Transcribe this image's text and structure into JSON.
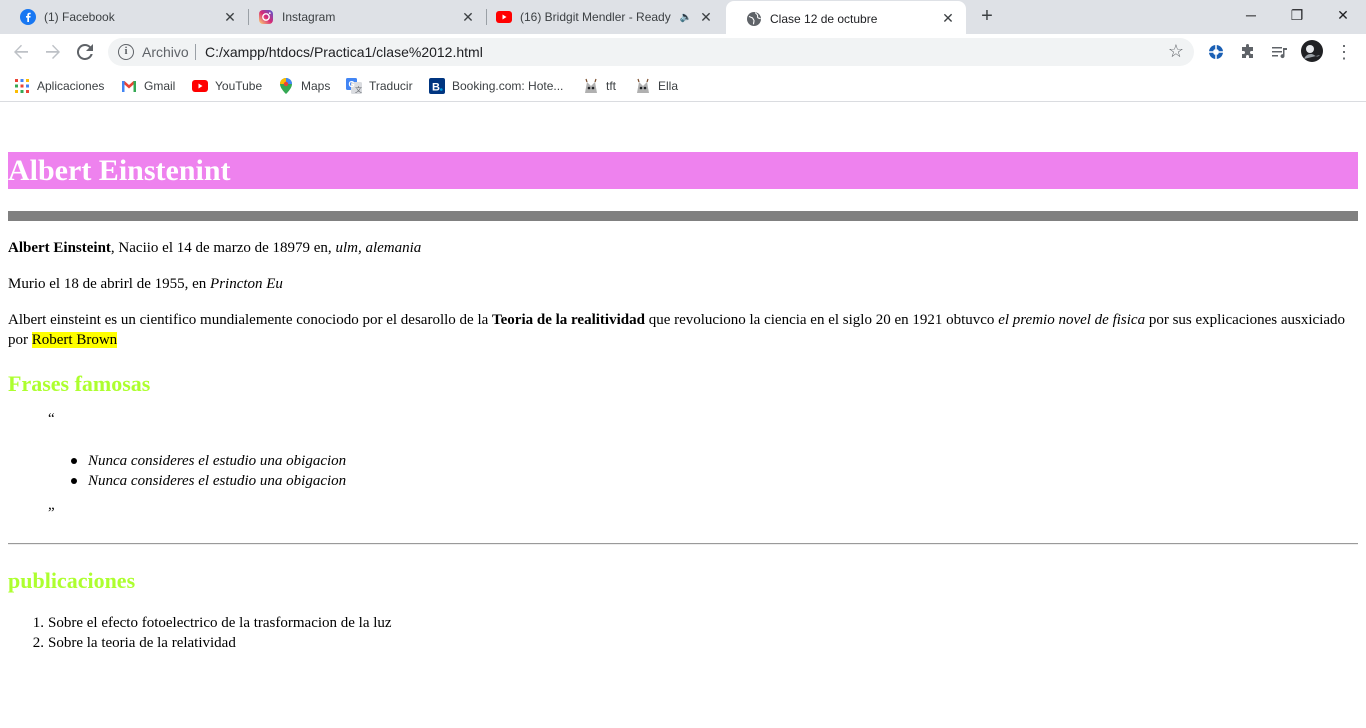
{
  "tabs": [
    {
      "title": "(1) Facebook",
      "icon": "facebook-icon",
      "color": "#1877f2"
    },
    {
      "title": "Instagram",
      "icon": "instagram-icon",
      "color": "#e1306c"
    },
    {
      "title": "(16) Bridgit Mendler - Ready",
      "icon": "youtube-icon",
      "color": "#ff0000",
      "audio": "🔈"
    },
    {
      "title": "Clase 12 de octubre",
      "icon": "globe-icon",
      "active": true
    }
  ],
  "window": {
    "minimize": "─",
    "restore": "❐",
    "close": "✕",
    "new_tab": "+"
  },
  "toolbar": {
    "scheme_label": "Archivo",
    "url": "C:/xampp/htdocs/Practica1/clase%2012.html"
  },
  "bookmarks": [
    {
      "label": "Aplicaciones",
      "icon": "apps-grid-icon"
    },
    {
      "label": "Gmail",
      "icon": "gmail-icon"
    },
    {
      "label": "YouTube",
      "icon": "youtube-icon"
    },
    {
      "label": "Maps",
      "icon": "maps-pin-icon"
    },
    {
      "label": "Traducir",
      "icon": "translate-icon"
    },
    {
      "label": "Booking.com: Hote...",
      "icon": "booking-icon"
    },
    {
      "label": "tft",
      "icon": "tft-icon"
    },
    {
      "label": "Ella",
      "icon": "ella-icon"
    }
  ],
  "page": {
    "heading": "Albert Einstenint",
    "p1": {
      "bold": "Albert Einsteint",
      "text": ", Naciio el 14 de marzo de 18979 en, ",
      "italic": "ulm, alemania"
    },
    "p2": {
      "text": "Murio el 18 de abrirl de 1955, en ",
      "italic": "Princton Eu"
    },
    "p3": {
      "t1": "Albert einsteint es un cientifico mundialemente conociodo por el desarollo de la ",
      "b1": "Teoria de la realitividad",
      "t2": " que revoluciono la ciencia en el siglo 20 en 1921 obtuvco ",
      "i1": "el premio novel de fisica",
      "t3": " por sus explicaciones ausxiciado por ",
      "mark": "Robert Brown"
    },
    "frases_heading": "Frases famosas",
    "quote_open": "“",
    "quote_close": "”",
    "frases": [
      "Nunca consideres el estudio una obigacion",
      "Nunca consideres el estudio una obigacion"
    ],
    "publicaciones_heading": "publicaciones",
    "publicaciones": [
      {
        "num": "1.",
        "text": "Sobre el efecto fotoelectrico de la trasformacion de la luz"
      },
      {
        "num": "2.",
        "text": "Sobre la teoria de la relatividad"
      }
    ],
    "colors": {
      "heading_bg": "#ee82ee",
      "subheading": "#adff2f",
      "highlight": "#ffff00",
      "rule": "#808080"
    }
  }
}
